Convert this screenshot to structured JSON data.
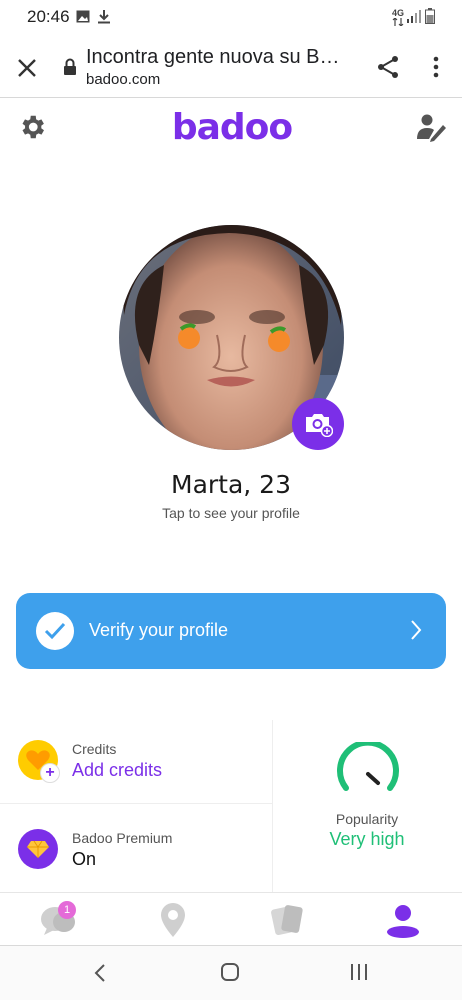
{
  "status_bar": {
    "time": "20:46",
    "network": "4G"
  },
  "browser": {
    "title": "Incontra gente nuova su Badoo.com",
    "domain": "badoo.com"
  },
  "app": {
    "logo_text": "badoo",
    "brand_color": "#7b2fe8"
  },
  "profile": {
    "name": "Marta, 23",
    "hint": "Tap to see your profile"
  },
  "verify": {
    "label": "Verify your profile",
    "color": "#3ea0ec"
  },
  "credits": {
    "title": "Credits",
    "action": "Add credits"
  },
  "premium": {
    "title": "Badoo Premium",
    "value": "On"
  },
  "popularity": {
    "title": "Popularity",
    "value": "Very high",
    "color": "#1fbf77"
  },
  "nav": {
    "badge_count": "1",
    "items": [
      "chat-icon",
      "location-pin-icon",
      "cards-icon",
      "profile-icon"
    ]
  }
}
